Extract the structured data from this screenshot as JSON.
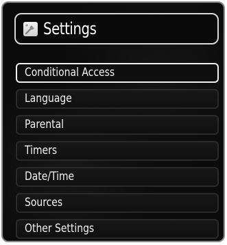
{
  "window": {
    "title": "Settings",
    "title_icon": "settings-wrench-icon"
  },
  "menu": {
    "selected_index": 0,
    "items": [
      {
        "label": "Conditional Access"
      },
      {
        "label": "Language"
      },
      {
        "label": "Parental"
      },
      {
        "label": "Timers"
      },
      {
        "label": "Date/Time"
      },
      {
        "label": "Sources"
      },
      {
        "label": "Other Settings"
      }
    ]
  },
  "colors": {
    "panel_background": "#0b0b0b",
    "panel_border": "#8a8a8a",
    "selected_border": "#f0f0f0",
    "text": "#f4f4f4"
  }
}
